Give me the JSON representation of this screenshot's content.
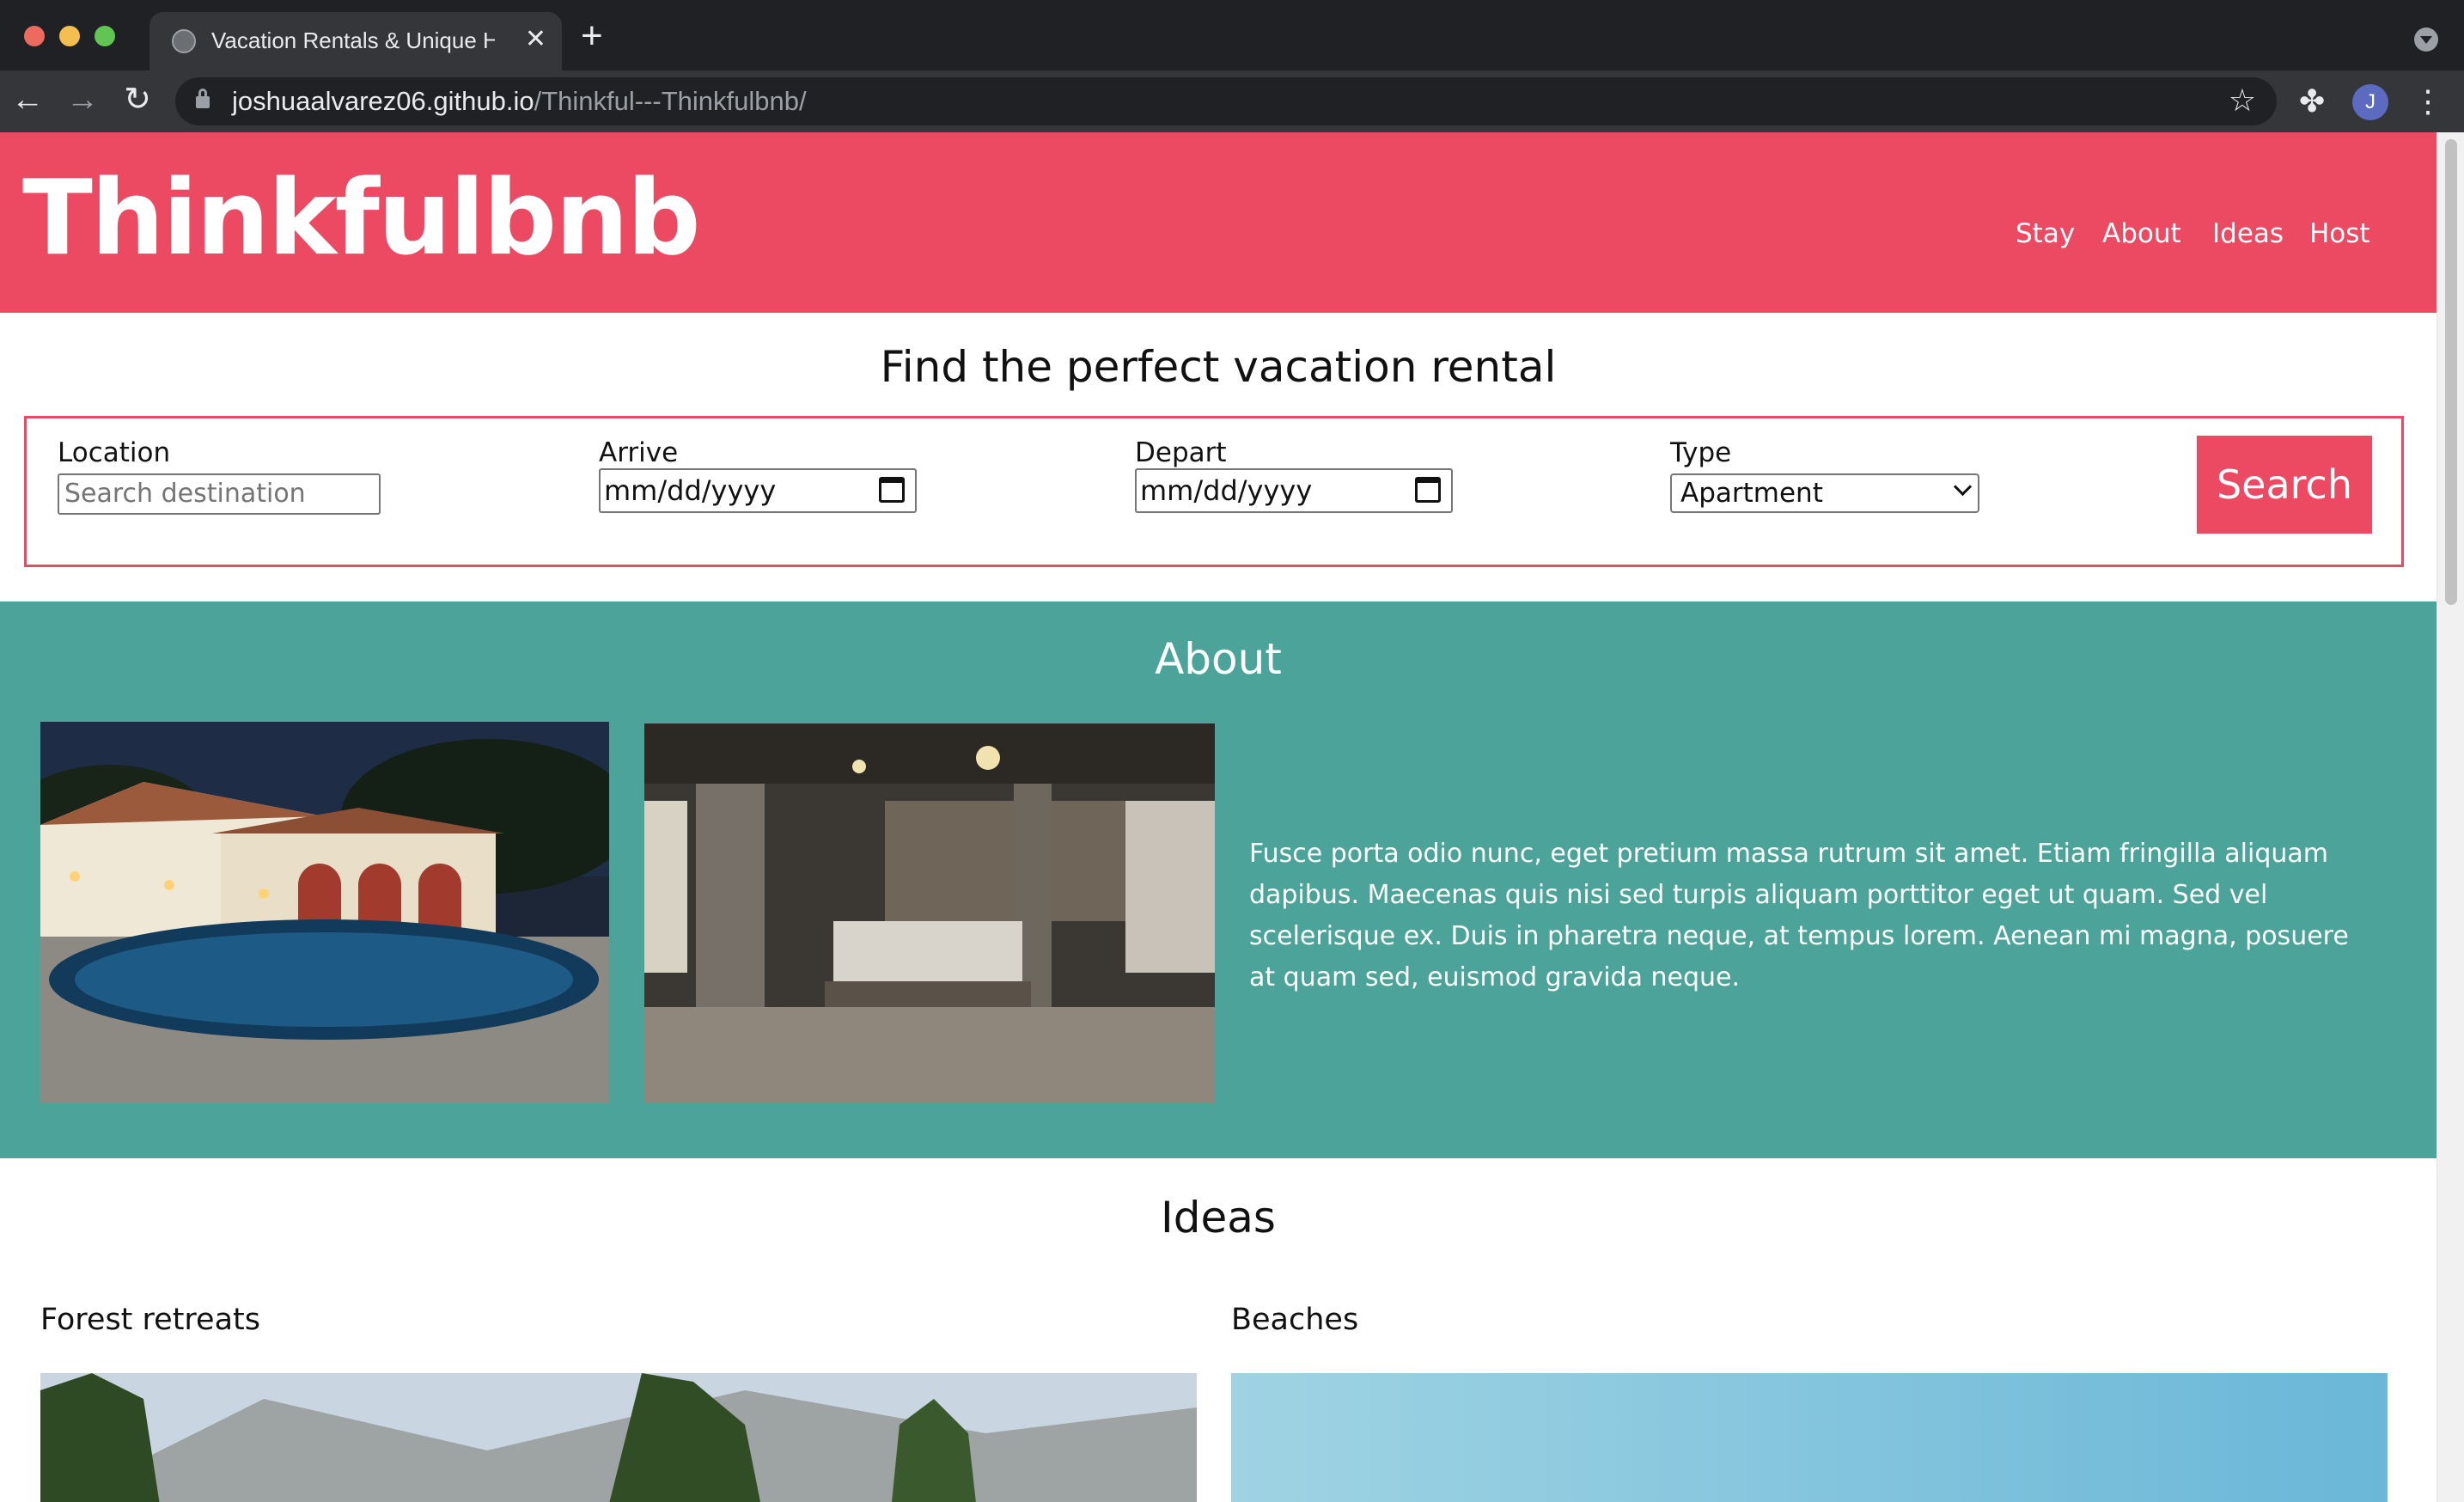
{
  "browser": {
    "tab_title": "Vacation Rentals & Unique Homes",
    "tab_close": "✕",
    "new_tab": "+",
    "url_host": "joshuaalvarez06.github.io",
    "url_path": "/Thinkful---Thinkfulbnb/",
    "avatar_initial": "J"
  },
  "header": {
    "logo": "Thinkfulbnb",
    "nav": [
      "Stay",
      "About",
      "Ideas",
      "Host"
    ]
  },
  "search": {
    "title": "Find the perfect vacation rental",
    "location_label": "Location",
    "location_placeholder": "Search destination",
    "arrive_label": "Arrive",
    "arrive_value": "mm/dd/yyyy",
    "depart_label": "Depart",
    "depart_value": "mm/dd/yyyy",
    "type_label": "Type",
    "type_selected": "Apartment",
    "button": "Search"
  },
  "about": {
    "title": "About",
    "text": "Fusce porta odio nunc, eget pretium massa rutrum sit amet. Etiam fringilla aliquam dapibus. Maecenas quis nisi sed turpis aliquam porttitor eget ut quam. Sed vel scelerisque ex. Duis in pharetra neque, at tempus lorem. Aenean mi magna, posuere at quam sed, euismod gravida neque."
  },
  "ideas": {
    "title": "Ideas",
    "items": [
      "Forest retreats",
      "Beaches"
    ]
  },
  "colors": {
    "brand": "#eb4a62",
    "about_bg": "#4ba399"
  }
}
